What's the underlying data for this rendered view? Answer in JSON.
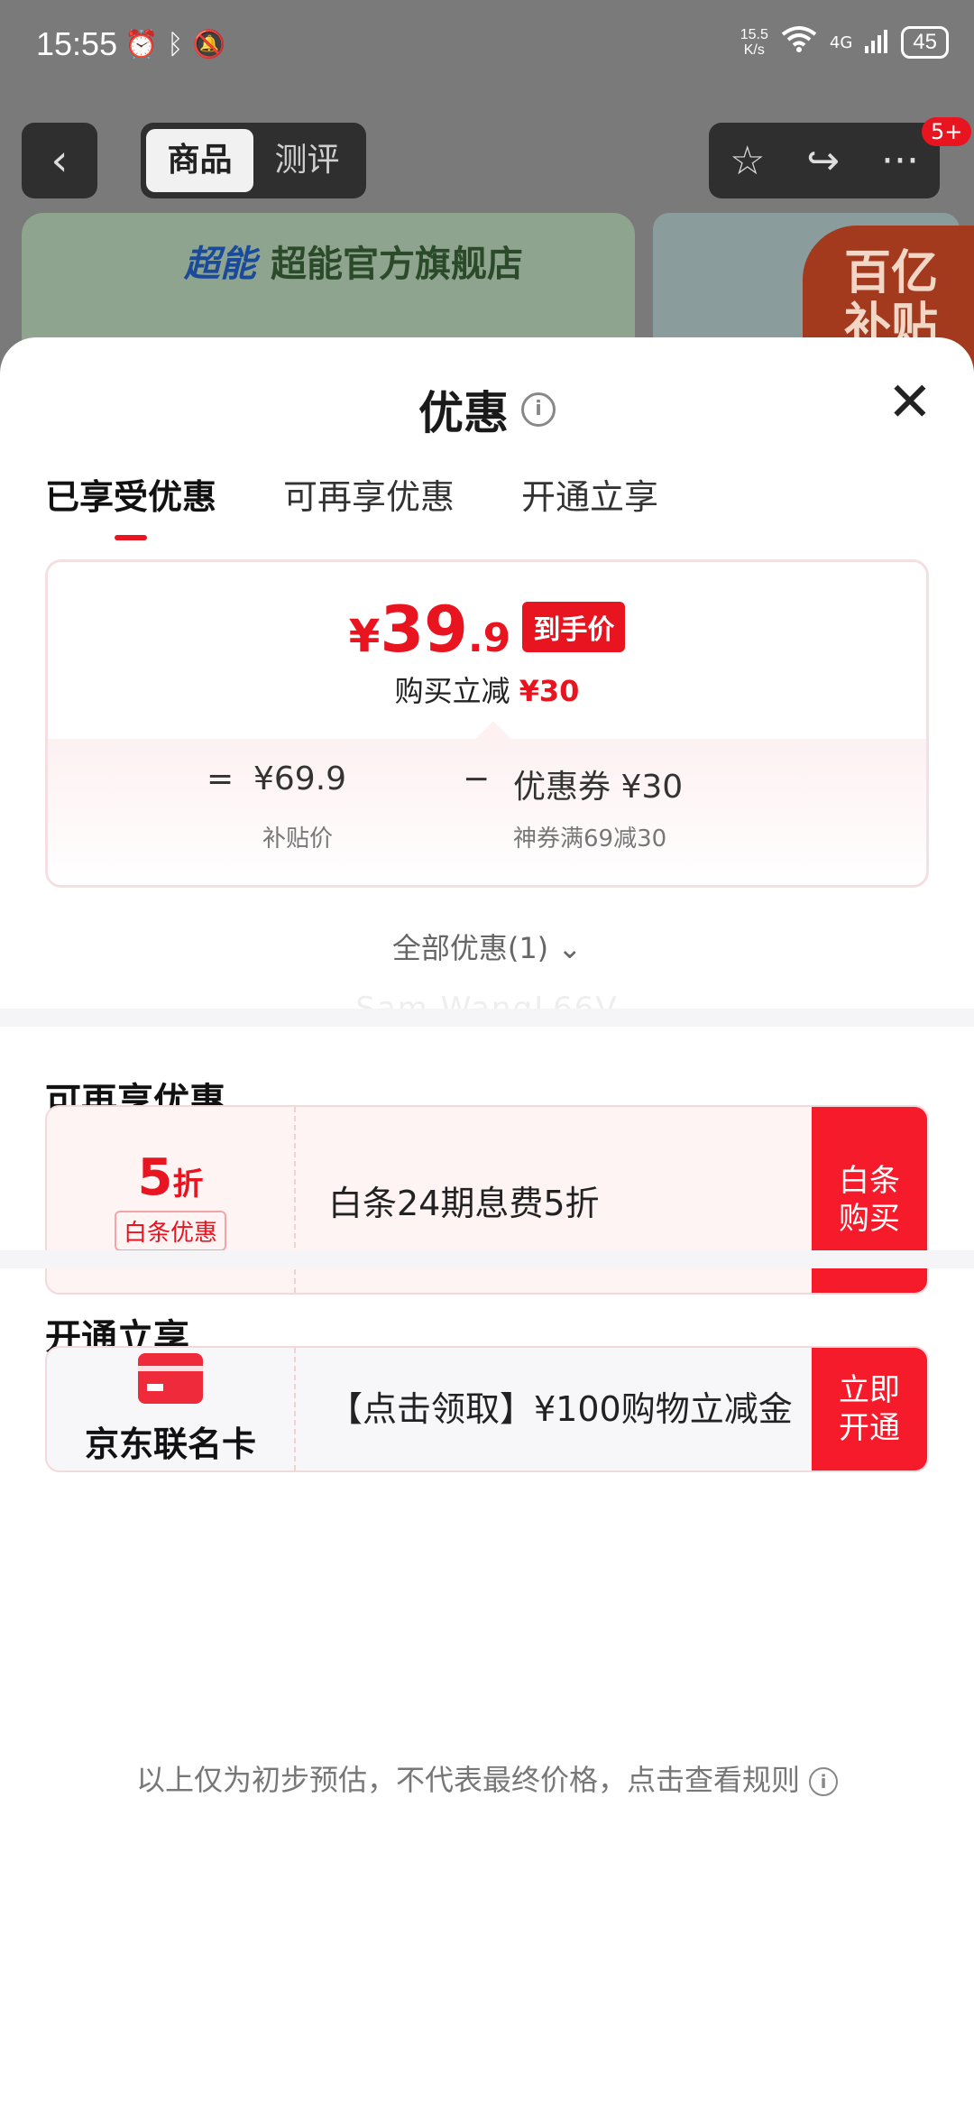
{
  "status_bar": {
    "time": "15:55",
    "icons": [
      "alarm-icon",
      "bluetooth-icon",
      "mute-icon"
    ],
    "speed_value": "15.5",
    "speed_unit": "K/s",
    "network": "4G",
    "battery": "45"
  },
  "background_page": {
    "tabs": [
      {
        "label": "商品",
        "active": true
      },
      {
        "label": "测评",
        "active": false
      }
    ],
    "badge": "5+",
    "store_name": "超能官方旗舰店",
    "store_logo_text": "超能",
    "promo_text_1": "百亿",
    "promo_text_2": "补贴"
  },
  "sheet": {
    "title": "优惠",
    "tabs": [
      {
        "label": "已享受优惠",
        "active": true
      },
      {
        "label": "可再享优惠",
        "active": false
      },
      {
        "label": "开通立享",
        "active": false
      }
    ],
    "price_card": {
      "currency": "¥",
      "price_int": "39",
      "price_dec": ".9",
      "price_tag": "到手价",
      "reduce_label": "购买立减",
      "reduce_amount": "¥30",
      "eq": "=",
      "subsidy_price": "¥69.9",
      "subsidy_label": "补贴价",
      "minus": "−",
      "coupon_label": "优惠券 ¥30",
      "coupon_desc": "神券满69减30"
    },
    "all_deals_label": "全部优惠(1)",
    "watermark": "Sam.WangL66V",
    "section_more": {
      "title": "可再享优惠",
      "discount_value": "5",
      "discount_unit": "折",
      "discount_label": "白条优惠",
      "description": "白条24期息费5折",
      "button": "白条购买"
    },
    "section_open": {
      "title": "开通立享",
      "card_name": "京东联名卡",
      "description": "【点击领取】¥100购物立减金",
      "button": "立即开通"
    },
    "disclaimer": "以上仅为初步预估，不代表最终价格，点击查看规则"
  },
  "colors": {
    "accent": "#e8141f",
    "button_red": "#f51b2b",
    "overlay": "#7a7a7a"
  }
}
